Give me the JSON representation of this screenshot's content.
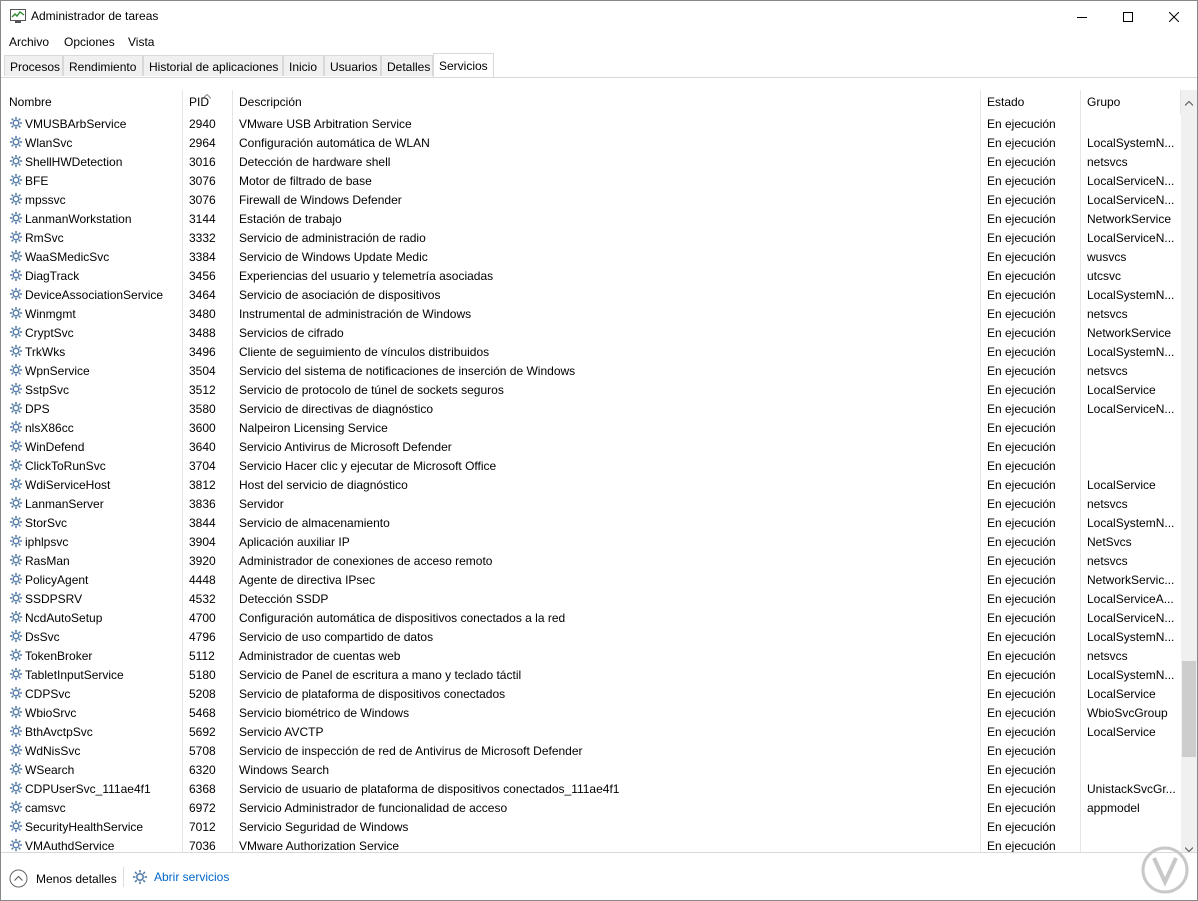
{
  "window": {
    "title": "Administrador de tareas",
    "icon": "task-manager-icon"
  },
  "menu": [
    "Archivo",
    "Opciones",
    "Vista"
  ],
  "tabs": [
    {
      "label": "Procesos",
      "active": false
    },
    {
      "label": "Rendimiento",
      "active": false
    },
    {
      "label": "Historial de aplicaciones",
      "active": false
    },
    {
      "label": "Inicio",
      "active": false
    },
    {
      "label": "Usuarios",
      "active": false
    },
    {
      "label": "Detalles",
      "active": false
    },
    {
      "label": "Servicios",
      "active": true
    }
  ],
  "columns": {
    "name": "Nombre",
    "pid": "PID",
    "description": "Descripción",
    "status": "Estado",
    "group": "Grupo"
  },
  "services": [
    {
      "name": "VMUSBArbService",
      "pid": "2940",
      "description": "VMware USB Arbitration Service",
      "status": "En ejecución",
      "group": ""
    },
    {
      "name": "WlanSvc",
      "pid": "2964",
      "description": "Configuración automática de WLAN",
      "status": "En ejecución",
      "group": "LocalSystemN..."
    },
    {
      "name": "ShellHWDetection",
      "pid": "3016",
      "description": "Detección de hardware shell",
      "status": "En ejecución",
      "group": "netsvcs"
    },
    {
      "name": "BFE",
      "pid": "3076",
      "description": "Motor de filtrado de base",
      "status": "En ejecución",
      "group": "LocalServiceN..."
    },
    {
      "name": "mpssvc",
      "pid": "3076",
      "description": "Firewall de Windows Defender",
      "status": "En ejecución",
      "group": "LocalServiceN..."
    },
    {
      "name": "LanmanWorkstation",
      "pid": "3144",
      "description": "Estación de trabajo",
      "status": "En ejecución",
      "group": "NetworkService"
    },
    {
      "name": "RmSvc",
      "pid": "3332",
      "description": "Servicio de administración de radio",
      "status": "En ejecución",
      "group": "LocalServiceN..."
    },
    {
      "name": "WaaSMedicSvc",
      "pid": "3384",
      "description": "Servicio de Windows Update Medic",
      "status": "En ejecución",
      "group": "wusvcs"
    },
    {
      "name": "DiagTrack",
      "pid": "3456",
      "description": "Experiencias del usuario y telemetría asociadas",
      "status": "En ejecución",
      "group": "utcsvc"
    },
    {
      "name": "DeviceAssociationService",
      "pid": "3464",
      "description": "Servicio de asociación de dispositivos",
      "status": "En ejecución",
      "group": "LocalSystemN..."
    },
    {
      "name": "Winmgmt",
      "pid": "3480",
      "description": "Instrumental de administración de Windows",
      "status": "En ejecución",
      "group": "netsvcs"
    },
    {
      "name": "CryptSvc",
      "pid": "3488",
      "description": "Servicios de cifrado",
      "status": "En ejecución",
      "group": "NetworkService"
    },
    {
      "name": "TrkWks",
      "pid": "3496",
      "description": "Cliente de seguimiento de vínculos distribuidos",
      "status": "En ejecución",
      "group": "LocalSystemN..."
    },
    {
      "name": "WpnService",
      "pid": "3504",
      "description": "Servicio del sistema de notificaciones de inserción de Windows",
      "status": "En ejecución",
      "group": "netsvcs"
    },
    {
      "name": "SstpSvc",
      "pid": "3512",
      "description": "Servicio de protocolo de túnel de sockets seguros",
      "status": "En ejecución",
      "group": "LocalService"
    },
    {
      "name": "DPS",
      "pid": "3580",
      "description": "Servicio de directivas de diagnóstico",
      "status": "En ejecución",
      "group": "LocalServiceN..."
    },
    {
      "name": "nlsX86cc",
      "pid": "3600",
      "description": "Nalpeiron Licensing Service",
      "status": "En ejecución",
      "group": ""
    },
    {
      "name": "WinDefend",
      "pid": "3640",
      "description": "Servicio Antivirus de Microsoft Defender",
      "status": "En ejecución",
      "group": ""
    },
    {
      "name": "ClickToRunSvc",
      "pid": "3704",
      "description": "Servicio Hacer clic y ejecutar de Microsoft Office",
      "status": "En ejecución",
      "group": ""
    },
    {
      "name": "WdiServiceHost",
      "pid": "3812",
      "description": "Host del servicio de diagnóstico",
      "status": "En ejecución",
      "group": "LocalService"
    },
    {
      "name": "LanmanServer",
      "pid": "3836",
      "description": "Servidor",
      "status": "En ejecución",
      "group": "netsvcs"
    },
    {
      "name": "StorSvc",
      "pid": "3844",
      "description": "Servicio de almacenamiento",
      "status": "En ejecución",
      "group": "LocalSystemN..."
    },
    {
      "name": "iphlpsvc",
      "pid": "3904",
      "description": "Aplicación auxiliar IP",
      "status": "En ejecución",
      "group": "NetSvcs"
    },
    {
      "name": "RasMan",
      "pid": "3920",
      "description": "Administrador de conexiones de acceso remoto",
      "status": "En ejecución",
      "group": "netsvcs"
    },
    {
      "name": "PolicyAgent",
      "pid": "4448",
      "description": "Agente de directiva IPsec",
      "status": "En ejecución",
      "group": "NetworkServic..."
    },
    {
      "name": "SSDPSRV",
      "pid": "4532",
      "description": "Detección SSDP",
      "status": "En ejecución",
      "group": "LocalServiceA..."
    },
    {
      "name": "NcdAutoSetup",
      "pid": "4700",
      "description": "Configuración automática de dispositivos conectados a la red",
      "status": "En ejecución",
      "group": "LocalServiceN..."
    },
    {
      "name": "DsSvc",
      "pid": "4796",
      "description": "Servicio de uso compartido de datos",
      "status": "En ejecución",
      "group": "LocalSystemN..."
    },
    {
      "name": "TokenBroker",
      "pid": "5112",
      "description": "Administrador de cuentas web",
      "status": "En ejecución",
      "group": "netsvcs"
    },
    {
      "name": "TabletInputService",
      "pid": "5180",
      "description": "Servicio de Panel de escritura a mano y teclado táctil",
      "status": "En ejecución",
      "group": "LocalSystemN..."
    },
    {
      "name": "CDPSvc",
      "pid": "5208",
      "description": "Servicio de plataforma de dispositivos conectados",
      "status": "En ejecución",
      "group": "LocalService"
    },
    {
      "name": "WbioSrvc",
      "pid": "5468",
      "description": "Servicio biométrico de Windows",
      "status": "En ejecución",
      "group": "WbioSvcGroup"
    },
    {
      "name": "BthAvctpSvc",
      "pid": "5692",
      "description": "Servicio AVCTP",
      "status": "En ejecución",
      "group": "LocalService"
    },
    {
      "name": "WdNisSvc",
      "pid": "5708",
      "description": "Servicio de inspección de red de Antivirus de Microsoft Defender",
      "status": "En ejecución",
      "group": ""
    },
    {
      "name": "WSearch",
      "pid": "6320",
      "description": "Windows Search",
      "status": "En ejecución",
      "group": ""
    },
    {
      "name": "CDPUserSvc_111ae4f1",
      "pid": "6368",
      "description": "Servicio de usuario de plataforma de dispositivos conectados_111ae4f1",
      "status": "En ejecución",
      "group": "UnistackSvcGr..."
    },
    {
      "name": "camsvc",
      "pid": "6972",
      "description": "Servicio Administrador de funcionalidad de acceso",
      "status": "En ejecución",
      "group": "appmodel"
    },
    {
      "name": "SecurityHealthService",
      "pid": "7012",
      "description": "Servicio Seguridad de Windows",
      "status": "En ejecución",
      "group": ""
    },
    {
      "name": "VMAuthdService",
      "pid": "7036",
      "description": "VMware Authorization Service",
      "status": "En ejecución",
      "group": ""
    }
  ],
  "footer": {
    "less_details": "Menos detalles",
    "open_services": "Abrir servicios"
  },
  "colors": {
    "link": "#0066cc",
    "icon_gear": "#5a7fa8",
    "border": "#d9d9d9"
  }
}
